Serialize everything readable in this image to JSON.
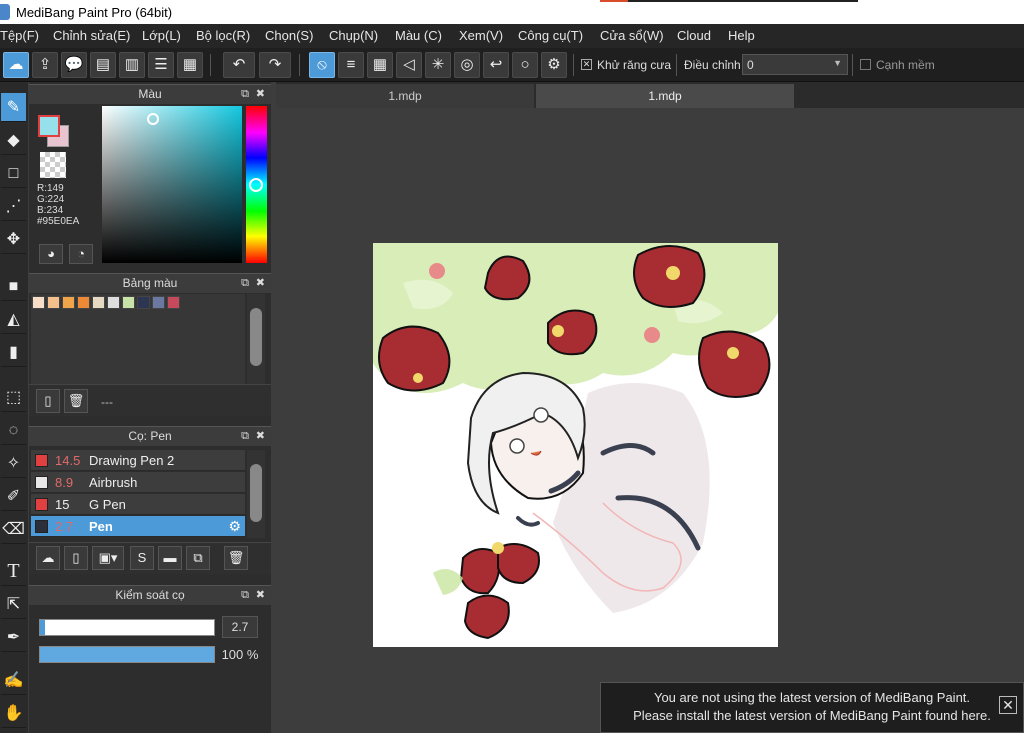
{
  "window": {
    "title": "MediBang Paint Pro (64bit)"
  },
  "menu": [
    "Tệp(F)",
    "Chỉnh sửa(E)",
    "Lớp(L)",
    "Bộ lọc(R)",
    "Chọn(S)",
    "Chụp(N)",
    "Màu (C)",
    "Xem(V)",
    "Công cụ(T)",
    "Cửa sổ(W)",
    "Cloud",
    "Help"
  ],
  "toolbar": {
    "antialias_label": "Khử răng cưa",
    "antialias_checked": true,
    "adjust_label": "Điều chỉnh",
    "adjust_value": "0",
    "soft_edge_label": "Cạnh mềm",
    "soft_edge_checked": false
  },
  "color_panel": {
    "title": "Màu",
    "current_color": "#95E0EA",
    "r": "R:149",
    "g": "G:224",
    "b": "B:234",
    "hex": "#95E0EA"
  },
  "palette_panel": {
    "title": "Bảng màu",
    "swatches": [
      "#f7dcc7",
      "#f5c08c",
      "#f0a54a",
      "#ee8a35",
      "#e6d9c4",
      "#dedede",
      "#c7e3a8",
      "#2c3552",
      "#6a78a2",
      "#c64a5c"
    ],
    "footer": "---"
  },
  "brush_panel": {
    "title": "Cọ: Pen",
    "items": [
      {
        "size": "14.5",
        "name": "Drawing Pen 2",
        "color": "#e0403f"
      },
      {
        "size": "8.9",
        "name": "Airbrush",
        "color": "#e8e8e8"
      },
      {
        "size": "15",
        "name": "G Pen",
        "color": "#e0403f"
      },
      {
        "size": "2.7",
        "name": "Pen",
        "color": "#2a2f3a"
      }
    ]
  },
  "brush_control": {
    "title": "Kiểm soát cọ",
    "size_value": "2.7",
    "opacity_value": "100 %",
    "size_fraction": 0.03,
    "opacity_fraction": 1.0
  },
  "tabs": [
    {
      "label": "1.mdp"
    },
    {
      "label": "1.mdp"
    }
  ],
  "notice": {
    "line1": "You are not using the latest version of MediBang Paint.",
    "line2": "Please install the latest version of MediBang Paint found here."
  }
}
